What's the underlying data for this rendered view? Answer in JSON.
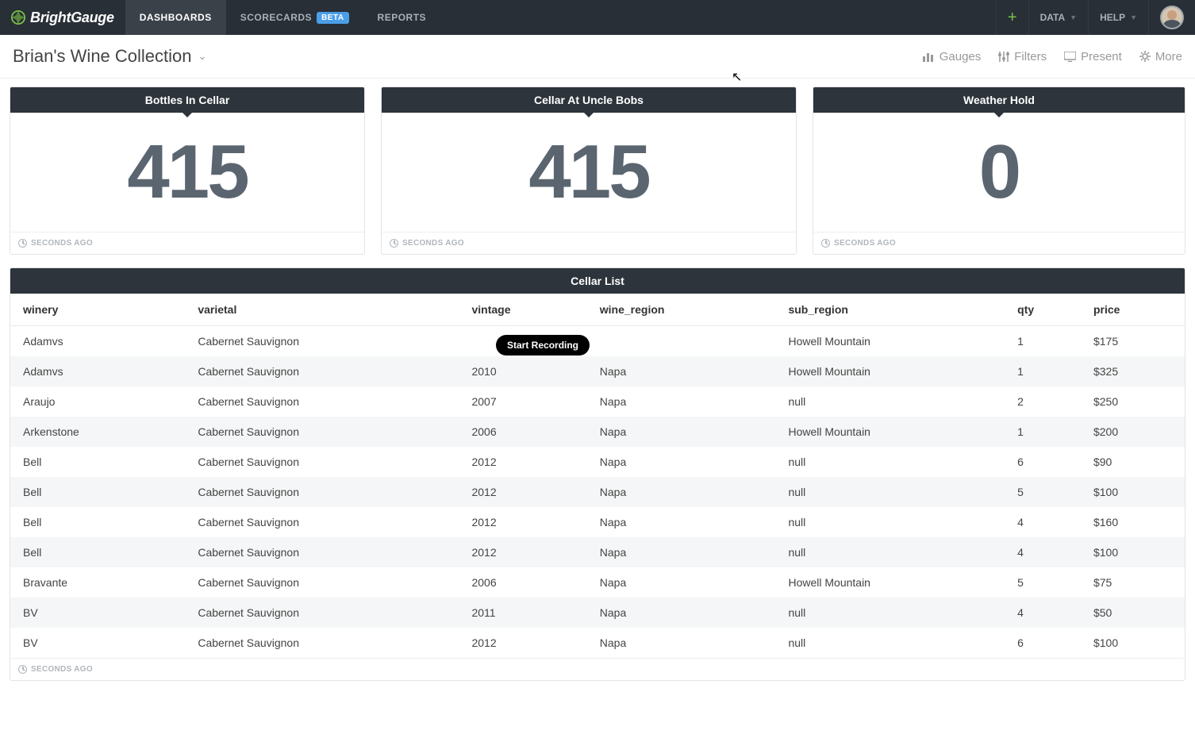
{
  "header": {
    "brand": "BrightGauge",
    "nav": [
      {
        "label": "DASHBOARDS",
        "active": true
      },
      {
        "label": "SCORECARDS",
        "badge": "BETA"
      },
      {
        "label": "REPORTS"
      }
    ],
    "data_label": "DATA",
    "help_label": "HELP"
  },
  "subheader": {
    "title": "Brian's Wine Collection",
    "actions": {
      "gauges": "Gauges",
      "filters": "Filters",
      "present": "Present",
      "more": "More"
    }
  },
  "cards": [
    {
      "title": "Bottles In Cellar",
      "value": "415",
      "footer": "SECONDS AGO"
    },
    {
      "title": "Cellar At Uncle Bobs",
      "value": "415",
      "footer": "SECONDS AGO"
    },
    {
      "title": "Weather Hold",
      "value": "0",
      "footer": "SECONDS AGO"
    }
  ],
  "table": {
    "title": "Cellar List",
    "footer": "SECONDS AGO",
    "columns": [
      "winery",
      "varietal",
      "vintage",
      "wine_region",
      "sub_region",
      "qty",
      "price"
    ],
    "rows": [
      {
        "winery": "Adamvs",
        "varietal": "Cabernet Sauvignon",
        "vintage": "",
        "wine_region": "",
        "sub_region": "Howell Mountain",
        "qty": "1",
        "price": "$175"
      },
      {
        "winery": "Adamvs",
        "varietal": "Cabernet Sauvignon",
        "vintage": "2010",
        "wine_region": "Napa",
        "sub_region": "Howell Mountain",
        "qty": "1",
        "price": "$325"
      },
      {
        "winery": "Araujo",
        "varietal": "Cabernet Sauvignon",
        "vintage": "2007",
        "wine_region": "Napa",
        "sub_region": "null",
        "qty": "2",
        "price": "$250"
      },
      {
        "winery": "Arkenstone",
        "varietal": "Cabernet Sauvignon",
        "vintage": "2006",
        "wine_region": "Napa",
        "sub_region": "Howell Mountain",
        "qty": "1",
        "price": "$200"
      },
      {
        "winery": "Bell",
        "varietal": "Cabernet Sauvignon",
        "vintage": "2012",
        "wine_region": "Napa",
        "sub_region": "null",
        "qty": "6",
        "price": "$90"
      },
      {
        "winery": "Bell",
        "varietal": "Cabernet Sauvignon",
        "vintage": "2012",
        "wine_region": "Napa",
        "sub_region": "null",
        "qty": "5",
        "price": "$100"
      },
      {
        "winery": "Bell",
        "varietal": "Cabernet Sauvignon",
        "vintage": "2012",
        "wine_region": "Napa",
        "sub_region": "null",
        "qty": "4",
        "price": "$160"
      },
      {
        "winery": "Bell",
        "varietal": "Cabernet Sauvignon",
        "vintage": "2012",
        "wine_region": "Napa",
        "sub_region": "null",
        "qty": "4",
        "price": "$100"
      },
      {
        "winery": "Bravante",
        "varietal": "Cabernet Sauvignon",
        "vintage": "2006",
        "wine_region": "Napa",
        "sub_region": "Howell Mountain",
        "qty": "5",
        "price": "$75"
      },
      {
        "winery": "BV",
        "varietal": "Cabernet Sauvignon",
        "vintage": "2011",
        "wine_region": "Napa",
        "sub_region": "null",
        "qty": "4",
        "price": "$50"
      },
      {
        "winery": "BV",
        "varietal": "Cabernet Sauvignon",
        "vintage": "2012",
        "wine_region": "Napa",
        "sub_region": "null",
        "qty": "6",
        "price": "$100"
      }
    ]
  },
  "overlay": {
    "text": "Start Recording"
  }
}
